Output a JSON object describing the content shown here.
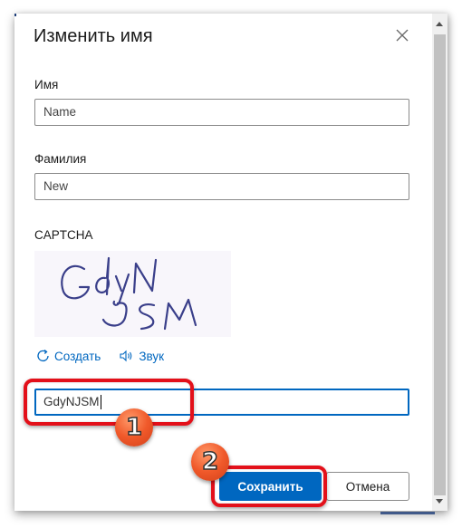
{
  "dialog": {
    "title": "Изменить имя",
    "close_icon": "close-icon"
  },
  "form": {
    "first_name": {
      "label": "Имя",
      "value": "Name"
    },
    "last_name": {
      "label": "Фамилия",
      "value": "New"
    },
    "captcha": {
      "label": "CAPTCHA",
      "image_text": "GdyNJSM",
      "refresh_label": "Создать",
      "refresh_icon": "refresh-icon",
      "audio_label": "Звук",
      "audio_icon": "speaker-icon",
      "input_value": "GdyNJSM"
    }
  },
  "buttons": {
    "save_label": "Сохранить",
    "cancel_label": "Отмена"
  },
  "annotations": {
    "step1": "1",
    "step2": "2",
    "highlight_color": "#e3101a",
    "badge_color": "#f0592a"
  },
  "colors": {
    "accent": "#0067c0",
    "text": "#1b1b1b"
  }
}
